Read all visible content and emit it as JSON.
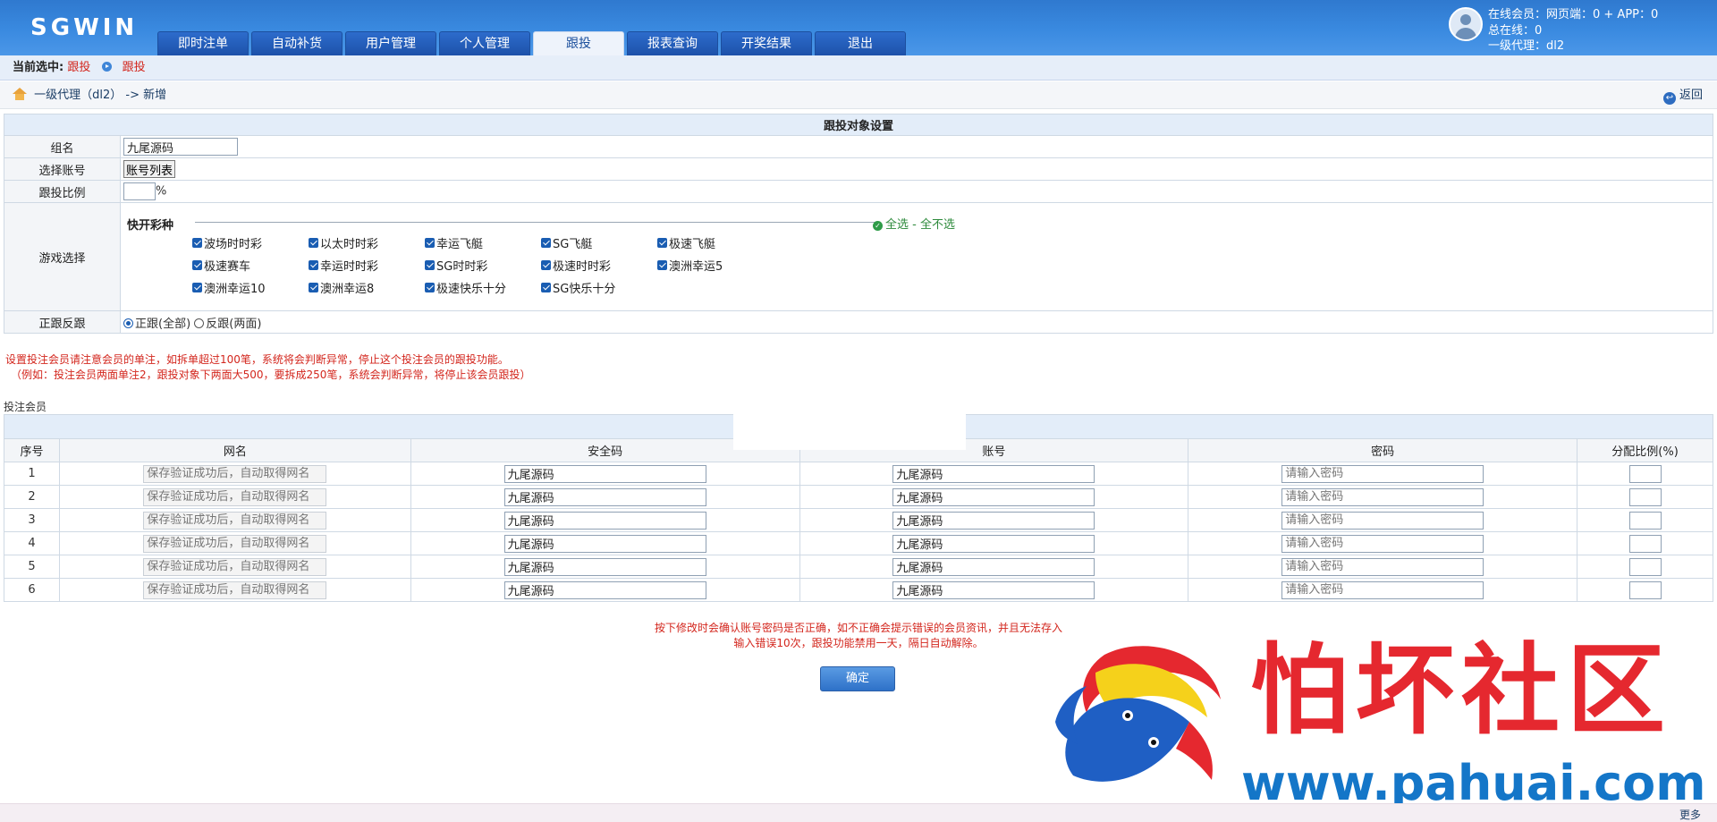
{
  "app": {
    "logo": "SGWIN"
  },
  "nav": {
    "tabs": [
      {
        "label": "即时注单"
      },
      {
        "label": "自动补货"
      },
      {
        "label": "用户管理"
      },
      {
        "label": "个人管理"
      },
      {
        "label": "跟投",
        "active": true
      },
      {
        "label": "报表查询"
      },
      {
        "label": "开奖结果"
      },
      {
        "label": "退出"
      }
    ]
  },
  "user": {
    "line1": "在线会员：网页端：0 + APP：0",
    "line2": "总在线：0",
    "line3": "一级代理：dl2"
  },
  "selection": {
    "label": "当前选中:",
    "item1": "跟投",
    "item2": "跟投"
  },
  "breadcrumb": {
    "path": "一级代理（dl2） -> 新增",
    "back": "返回"
  },
  "form": {
    "title": "跟投对象设置",
    "group_label": "组名",
    "group_value": "九尾源码",
    "account_label": "选择账号",
    "account_button": "账号列表",
    "ratio_label": "跟投比例",
    "ratio_value": "",
    "ratio_unit": "%",
    "games_label": "游戏选择",
    "games_category": "快开彩种",
    "select_all": "全选",
    "select_none": "全不选",
    "games": [
      [
        "波场时时彩",
        "以太时时彩",
        "幸运飞艇",
        "SG飞艇",
        "极速飞艇"
      ],
      [
        "极速赛车",
        "幸运时时彩",
        "SG时时彩",
        "极速时时彩",
        "澳洲幸运5"
      ],
      [
        "澳洲幸运10",
        "澳洲幸运8",
        "极速快乐十分",
        "SG快乐十分"
      ]
    ],
    "direction_label": "正跟反跟",
    "direction_opt1": "正跟(全部)",
    "direction_opt2": "反跟(两面)"
  },
  "notes": {
    "line1": "设置投注会员请注意会员的单注，如拆单超过100笔，系统将会判断异常，停止这个投注会员的跟投功能。",
    "line2": "（例如：投注会员两面单注2，跟投对象下两面大500，要拆成250笔，系统会判断异常，将停止该会员跟投）"
  },
  "members": {
    "label": "投注会员",
    "headers": [
      "序号",
      "网名",
      "安全码",
      "账号",
      "密码",
      "分配比例(%)"
    ],
    "nickname_placeholder": "保存验证成功后，自动取得网名",
    "password_placeholder": "请输入密码",
    "rows": [
      {
        "no": "1",
        "code": "九尾源码",
        "account": "九尾源码"
      },
      {
        "no": "2",
        "code": "九尾源码",
        "account": "九尾源码"
      },
      {
        "no": "3",
        "code": "九尾源码",
        "account": "九尾源码"
      },
      {
        "no": "4",
        "code": "九尾源码",
        "account": "九尾源码"
      },
      {
        "no": "5",
        "code": "九尾源码",
        "account": "九尾源码"
      },
      {
        "no": "6",
        "code": "九尾源码",
        "account": "九尾源码"
      }
    ]
  },
  "warning": {
    "line1": "按下修改时会确认账号密码是否正确，如不正确会提示错误的会员资讯，并且无法存入",
    "line2": "输入错误10次，跟投功能禁用一天，隔日自动解除。"
  },
  "confirm_button": "确定",
  "watermark": {
    "text": "怕坏社区",
    "url": "www.pahuai.com"
  },
  "footer": {
    "more": "更多"
  }
}
